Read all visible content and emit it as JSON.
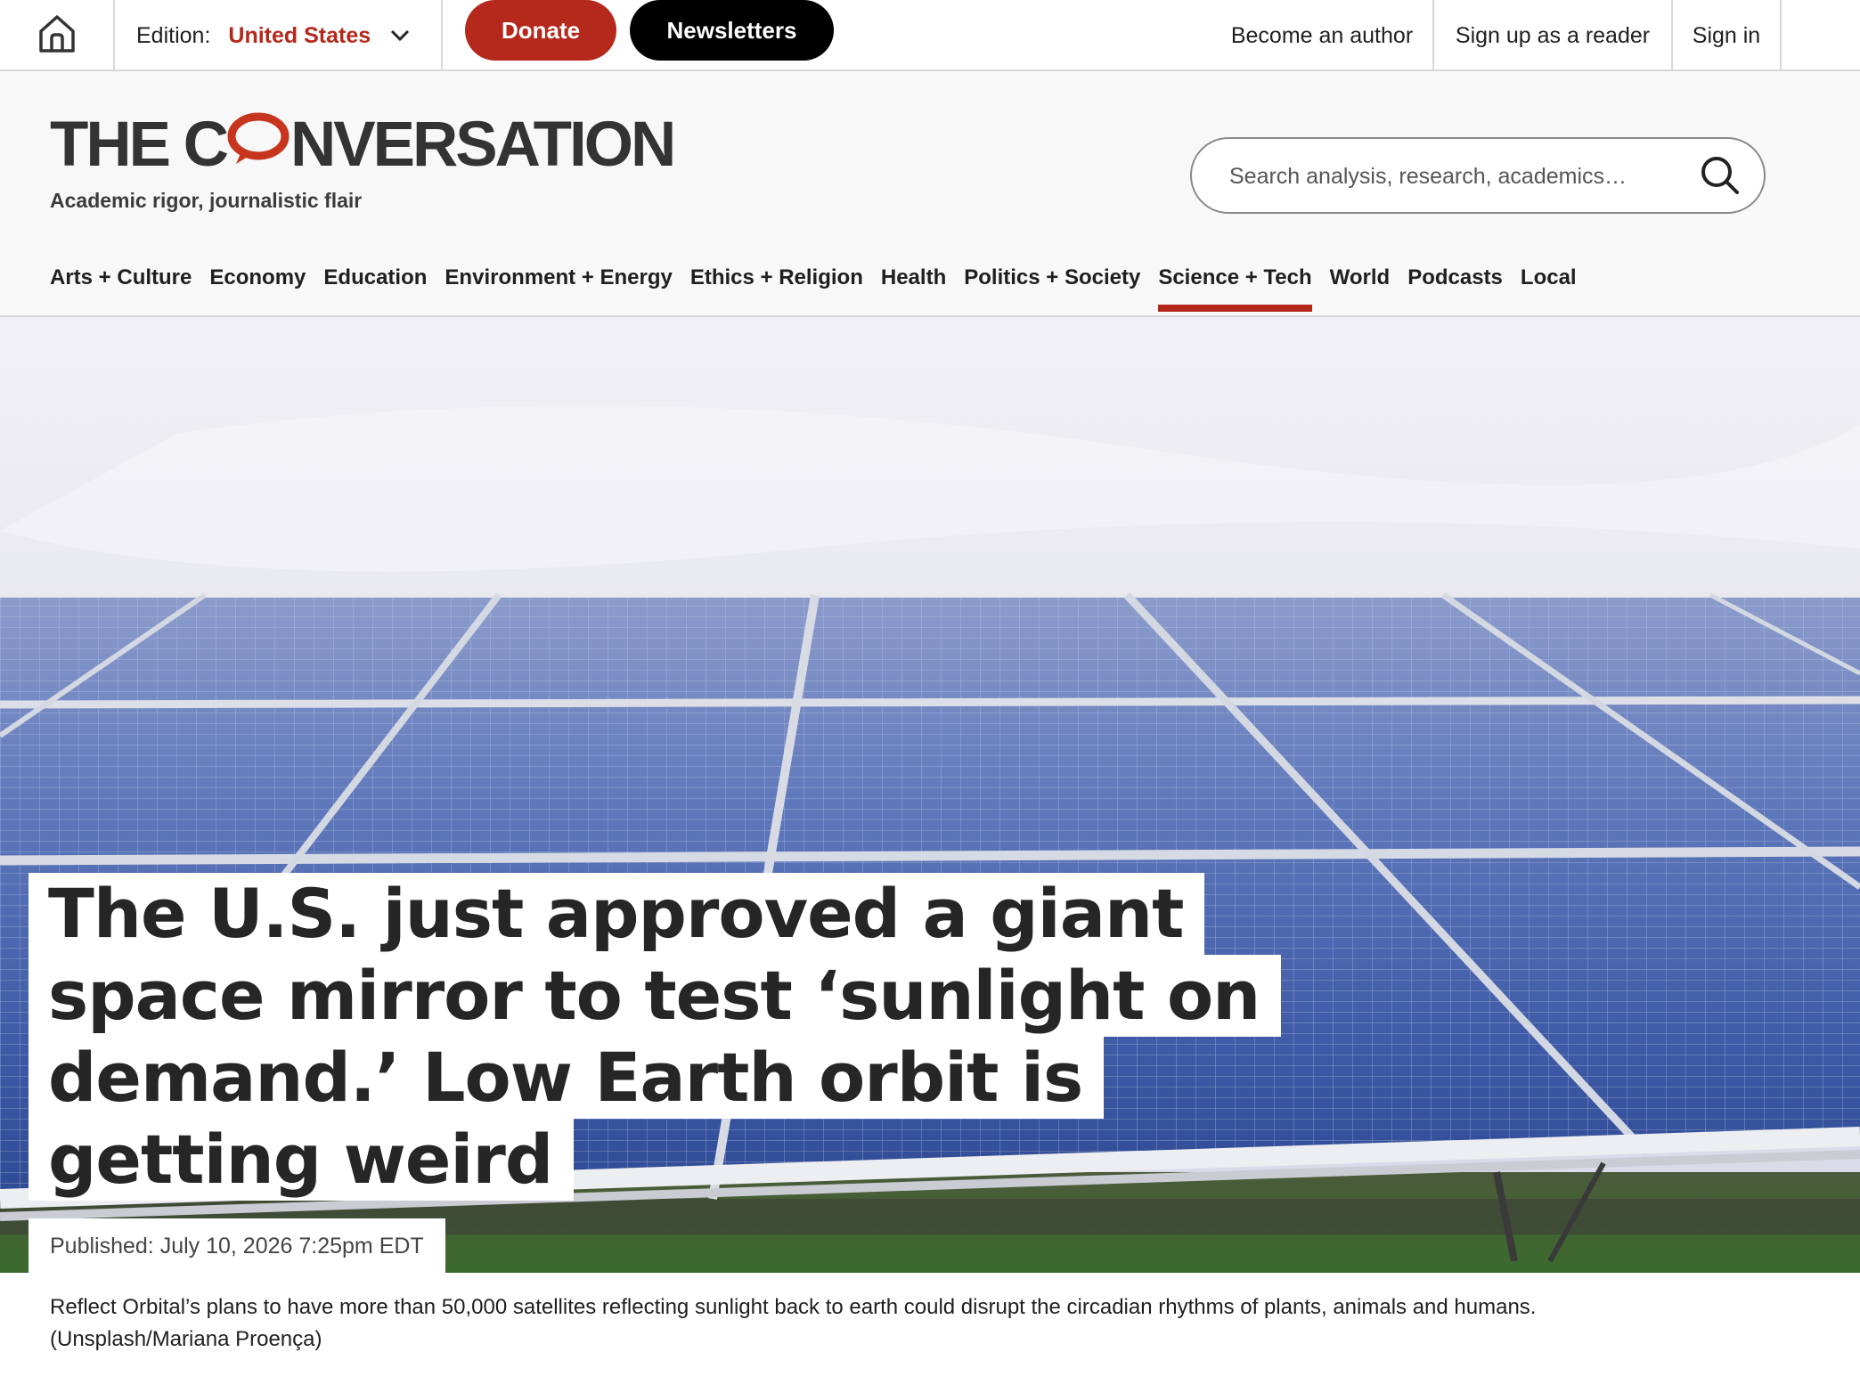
{
  "topbar": {
    "edition_label": "Edition:",
    "edition_value": "United States",
    "donate_label": "Donate",
    "newsletters_label": "Newsletters",
    "become_author": "Become an author",
    "sign_up_reader": "Sign up as a reader",
    "sign_in": "Sign in"
  },
  "masthead": {
    "logo_prefix": "THE C",
    "logo_suffix": "NVERSATION",
    "tagline": "Academic rigor, journalistic flair",
    "search_placeholder": "Search analysis, research, academics…"
  },
  "nav": {
    "items": [
      {
        "label": "Arts + Culture"
      },
      {
        "label": "Economy"
      },
      {
        "label": "Education"
      },
      {
        "label": "Environment + Energy"
      },
      {
        "label": "Ethics + Religion"
      },
      {
        "label": "Health"
      },
      {
        "label": "Politics + Society"
      },
      {
        "label": "Science + Tech"
      },
      {
        "label": "World"
      },
      {
        "label": "Podcasts"
      },
      {
        "label": "Local"
      }
    ],
    "active": "Science + Tech"
  },
  "article": {
    "headline_lines": [
      "The U.S. just approved a giant",
      "space mirror to test ‘sunlight on",
      "demand.’ Low Earth orbit is",
      "getting weird"
    ],
    "published": "Published: July 10, 2026 7:25pm EDT",
    "caption": "Reflect Orbital’s plans to have more than 50,000 satellites reflecting sunlight back to earth could disrupt the circadian rhythms of plants, animals and humans.",
    "credit": "(Unsplash/Mariana Proença)"
  },
  "colors": {
    "brand_red": "#b5291c",
    "black": "#000000",
    "masthead_bg": "#f8f8f8"
  },
  "icons": [
    "home-icon",
    "chevron-down-icon",
    "search-icon",
    "speech-bubble-logo-icon"
  ]
}
